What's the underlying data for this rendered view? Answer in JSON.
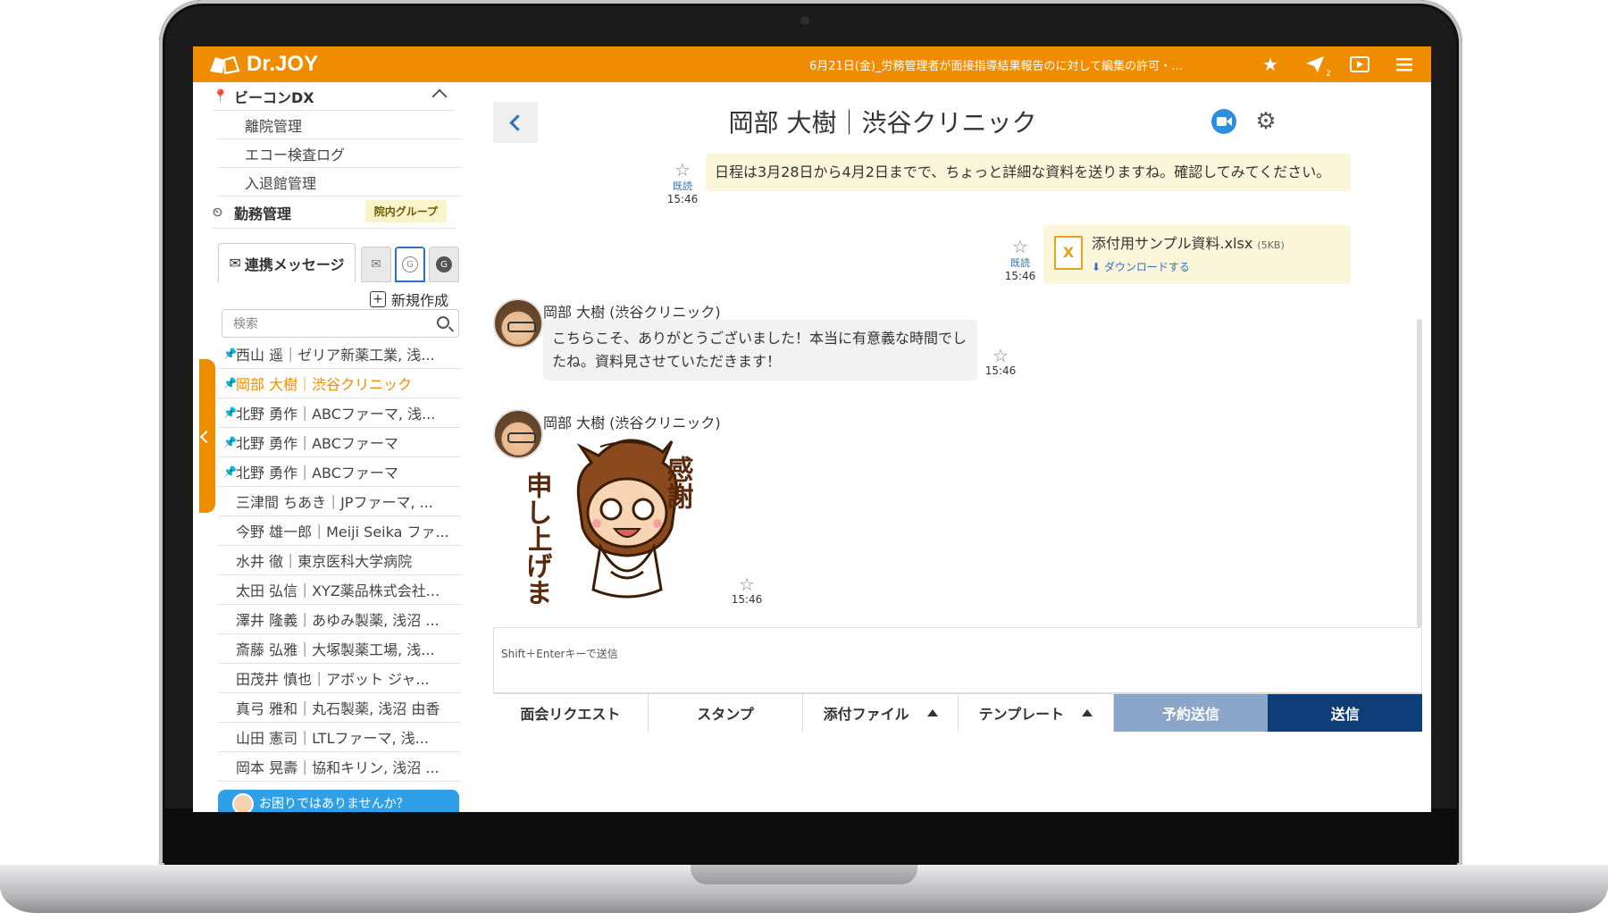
{
  "app": {
    "logo_text": "Dr.JOY",
    "ticker": "6月21日(金)_労務管理者が面接指導結果報告のに対して編集の許可・不...",
    "colors": {
      "brand": "#f08c00",
      "link": "#2f6fc0",
      "send": "#0e3e78",
      "reserve": "#8aa6c8",
      "help": "#2fa0e8"
    },
    "top_icons": [
      "star-icon",
      "send-plane-icon",
      "play-icon",
      "menu-icon"
    ],
    "send_count": "2"
  },
  "sidebar": {
    "section_beacon": "ビーコンDX",
    "beacon_items": [
      "離院管理",
      "エコー検査ログ",
      "入退館管理"
    ],
    "section_work": "勤務管理",
    "work_badge": "院内グループ",
    "msg_tab": "連携メッセージ",
    "new_create": "新規作成",
    "search_placeholder": "検索",
    "conversations": [
      {
        "label": "西山 遥｜ゼリア新薬工業, 浅...",
        "pinned": true,
        "active": false
      },
      {
        "label": "岡部 大樹｜渋谷クリニック",
        "pinned": true,
        "active": true
      },
      {
        "label": "北野 勇作｜ABCファーマ, 浅...",
        "pinned": true,
        "active": false
      },
      {
        "label": "北野 勇作｜ABCファーマ",
        "pinned": true,
        "active": false
      },
      {
        "label": "北野 勇作｜ABCファーマ",
        "pinned": true,
        "active": false
      },
      {
        "label": "三津間 ちあき｜JPファーマ, ...",
        "pinned": false,
        "active": false
      },
      {
        "label": "今野 雄一郎｜Meiji Seika ファ...",
        "pinned": false,
        "active": false
      },
      {
        "label": "水井 徹｜東京医科大学病院",
        "pinned": false,
        "active": false
      },
      {
        "label": "太田 弘信｜XYZ薬品株式会社...",
        "pinned": false,
        "active": false
      },
      {
        "label": "澤井 隆義｜あゆみ製薬, 浅沼 ...",
        "pinned": false,
        "active": false
      },
      {
        "label": "斎藤 弘雅｜大塚製薬工場, 浅...",
        "pinned": false,
        "active": false
      },
      {
        "label": "田茂井 慎也｜アボット ジャ...",
        "pinned": false,
        "active": false
      },
      {
        "label": "真弓 雅和｜丸石製薬, 浅沼 由香",
        "pinned": false,
        "active": false
      },
      {
        "label": "山田 憲司｜LTLファーマ, 浅...",
        "pinned": false,
        "active": false
      },
      {
        "label": "岡本 晃壽｜協和キリン, 浅沼 ...",
        "pinned": false,
        "active": false
      }
    ],
    "help_text": "お困りではありませんか？"
  },
  "chat": {
    "title": "岡部 大樹｜渋谷クリニック",
    "messages": [
      {
        "type": "text",
        "side": "mine",
        "text": "日程は3月28日から4月2日までで、ちょっと詳細な資料を送りますね。確認してみてください。",
        "read": "既読",
        "time": "15:46"
      },
      {
        "type": "file",
        "side": "mine",
        "file_name": "添付用サンプル資料.xlsx",
        "file_size": "(5KB)",
        "download": "ダウンロードする",
        "read": "既読",
        "time": "15:46"
      },
      {
        "type": "text",
        "side": "theirs",
        "sender": "岡部 大樹 (渋谷クリニック)",
        "text": "こちらこそ、ありがとうございました！本当に有意義な時間でしたね。資料見させていただきます！",
        "time": "15:46"
      },
      {
        "type": "stamp",
        "side": "theirs",
        "sender": "岡部 大樹 (渋谷クリニック)",
        "stamp_text_1": "申し上げます",
        "stamp_text_2": "感謝",
        "time": "15:46"
      }
    ],
    "compose_placeholder": "Shift＋Enterキーで送信",
    "buttons": {
      "meeting": "面会リクエスト",
      "stamp": "スタンプ",
      "attach": "添付ファイル",
      "template": "テンプレート",
      "reserve": "予約送信",
      "send": "送信"
    }
  }
}
